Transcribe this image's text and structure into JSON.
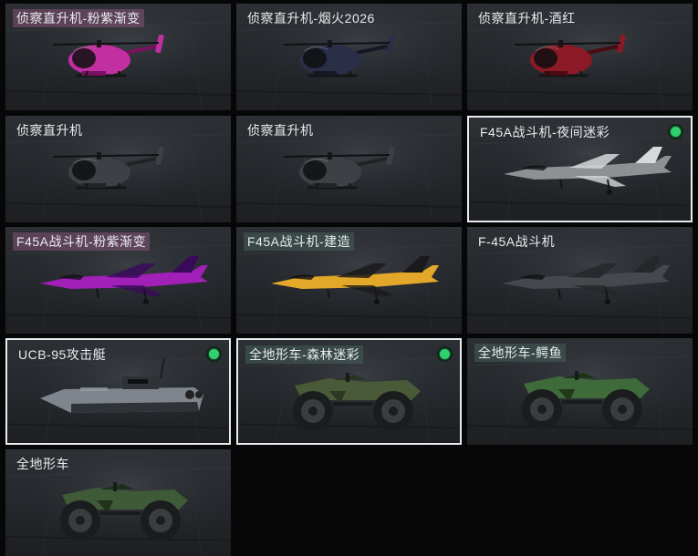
{
  "vehicles": [
    {
      "title": "侦察直升机-粉紫渐变",
      "type": "helicopter",
      "colors": [
        "#c22fa0",
        "#7a1060"
      ],
      "title_tint": "pink",
      "equipped": false
    },
    {
      "title": "侦察直升机-烟火2026",
      "type": "helicopter",
      "colors": [
        "#2a2e46",
        "#161826"
      ],
      "title_tint": "plain",
      "equipped": false
    },
    {
      "title": "侦察直升机-酒红",
      "type": "helicopter",
      "colors": [
        "#8b1a26",
        "#4a0c12"
      ],
      "title_tint": "plain",
      "equipped": false
    },
    {
      "title": "侦察直升机",
      "type": "helicopter",
      "colors": [
        "#3d4044",
        "#212325"
      ],
      "title_tint": "plain",
      "equipped": false
    },
    {
      "title": "侦察直升机",
      "type": "helicopter",
      "colors": [
        "#3d4044",
        "#212325"
      ],
      "title_tint": "plain",
      "equipped": false
    },
    {
      "title": "F45A战斗机-夜间迷彩",
      "type": "jet",
      "colors": [
        "#8d9194",
        "#d7d9db"
      ],
      "title_tint": "plain",
      "equipped": true
    },
    {
      "title": "F45A战斗机-粉紫渐变",
      "type": "jet",
      "colors": [
        "#a020b8",
        "#3a0a5a"
      ],
      "title_tint": "pink",
      "equipped": false
    },
    {
      "title": "F45A战斗机-建造",
      "type": "jet",
      "colors": [
        "#e3a72a",
        "#1a1a1a"
      ],
      "title_tint": "teal",
      "equipped": false
    },
    {
      "title": "F-45A战斗机",
      "type": "jet",
      "colors": [
        "#45484c",
        "#25272a"
      ],
      "title_tint": "plain",
      "equipped": false
    },
    {
      "title": "UCB-95攻击艇",
      "type": "boat",
      "colors": [
        "#7e858c",
        "#2f3236"
      ],
      "title_tint": "plain",
      "equipped": true
    },
    {
      "title": "全地形车-森林迷彩",
      "type": "atv",
      "colors": [
        "#4a5a38",
        "#2b3322"
      ],
      "title_tint": "teal",
      "equipped": true
    },
    {
      "title": "全地形车-鳄鱼",
      "type": "atv",
      "colors": [
        "#3f6a3a",
        "#1e3318"
      ],
      "title_tint": "teal",
      "equipped": false
    },
    {
      "title": "全地形车",
      "type": "atv",
      "colors": [
        "#3e5a36",
        "#1f2e1b"
      ],
      "title_tint": "plain",
      "equipped": false
    }
  ]
}
